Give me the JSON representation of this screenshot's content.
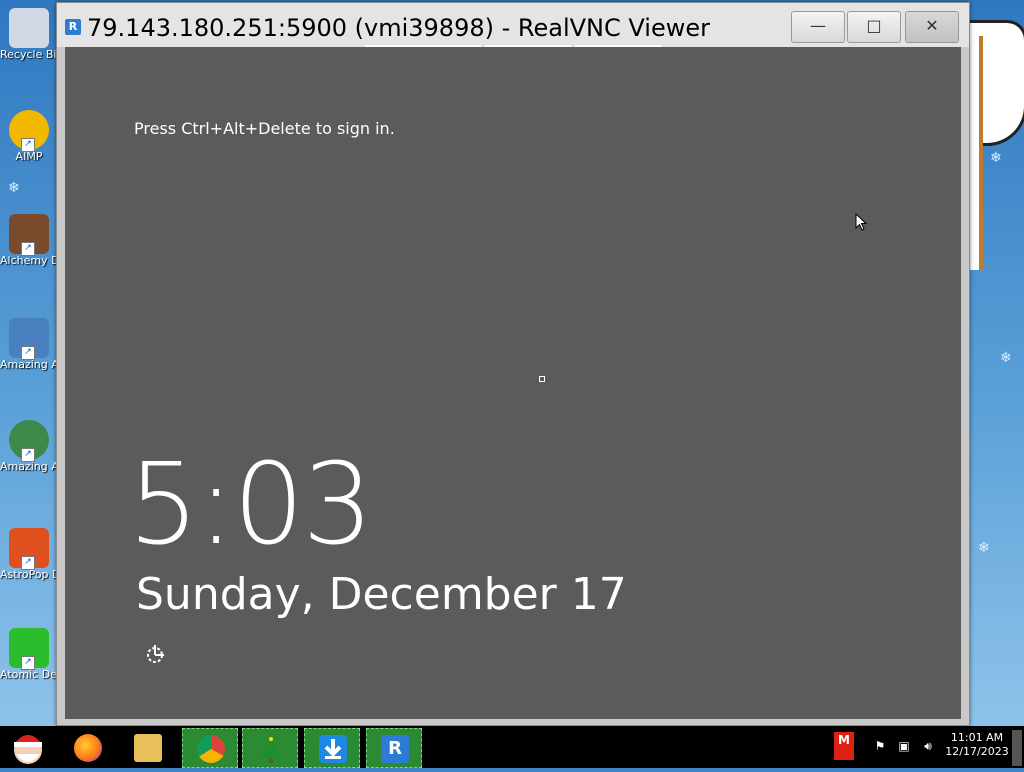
{
  "window": {
    "title": "79.143.180.251:5900 (vmi39898) - RealVNC Viewer",
    "app_icon_letter": "R",
    "minimize_glyph": "—",
    "maximize_glyph": "□",
    "close_glyph": "✕"
  },
  "remote": {
    "hint": "Press Ctrl+Alt+Delete to sign in.",
    "time": "5:03",
    "date": "Sunday, December 17",
    "ease_of_access_icon": "ease-of-access-icon"
  },
  "desktop": {
    "icons": [
      {
        "label": "Recycle Bin",
        "icon": "recycle-bin-icon",
        "color": "#cfd8e3"
      },
      {
        "label": "AIMP",
        "icon": "aimp-icon",
        "color": "#f2b800"
      },
      {
        "label": "Alchemy Deluxe",
        "icon": "alchemy-icon",
        "color": "#7a4a2a"
      },
      {
        "label": "Amazing Adventures",
        "icon": "amazing-adventures-icon",
        "color": "#4a7fc0"
      },
      {
        "label": "Amazing Adventures",
        "icon": "amazing-adventures-2-icon",
        "color": "#3c8a4a"
      },
      {
        "label": "AstroPop Deluxe",
        "icon": "astropop-icon",
        "color": "#e0501e"
      },
      {
        "label": "Atomic Deluxe",
        "icon": "atomic-icon",
        "color": "#2cbd2c"
      }
    ]
  },
  "taskbar": {
    "items": [
      {
        "name": "firefox",
        "icon": "firefox-icon",
        "color": "#ff7a1a",
        "active": false
      },
      {
        "name": "file-explorer",
        "icon": "folder-icon",
        "color": "#e8c15a",
        "active": false
      },
      {
        "name": "chrome",
        "icon": "chrome-icon",
        "color": "#db4437",
        "active": true
      },
      {
        "name": "christmas-tree",
        "icon": "tree-icon",
        "color": "#1e8f2a",
        "active": true
      },
      {
        "name": "downloader",
        "icon": "download-icon",
        "color": "#1e88e5",
        "active": true
      },
      {
        "name": "realvnc",
        "icon": "realvnc-icon",
        "color": "#2c7cd6",
        "active": true
      }
    ],
    "tray": {
      "time": "11:01 AM",
      "date": "12/17/2023",
      "icons": [
        "antivirus-icon",
        "flag-icon",
        "network-icon",
        "volume-icon"
      ]
    }
  }
}
